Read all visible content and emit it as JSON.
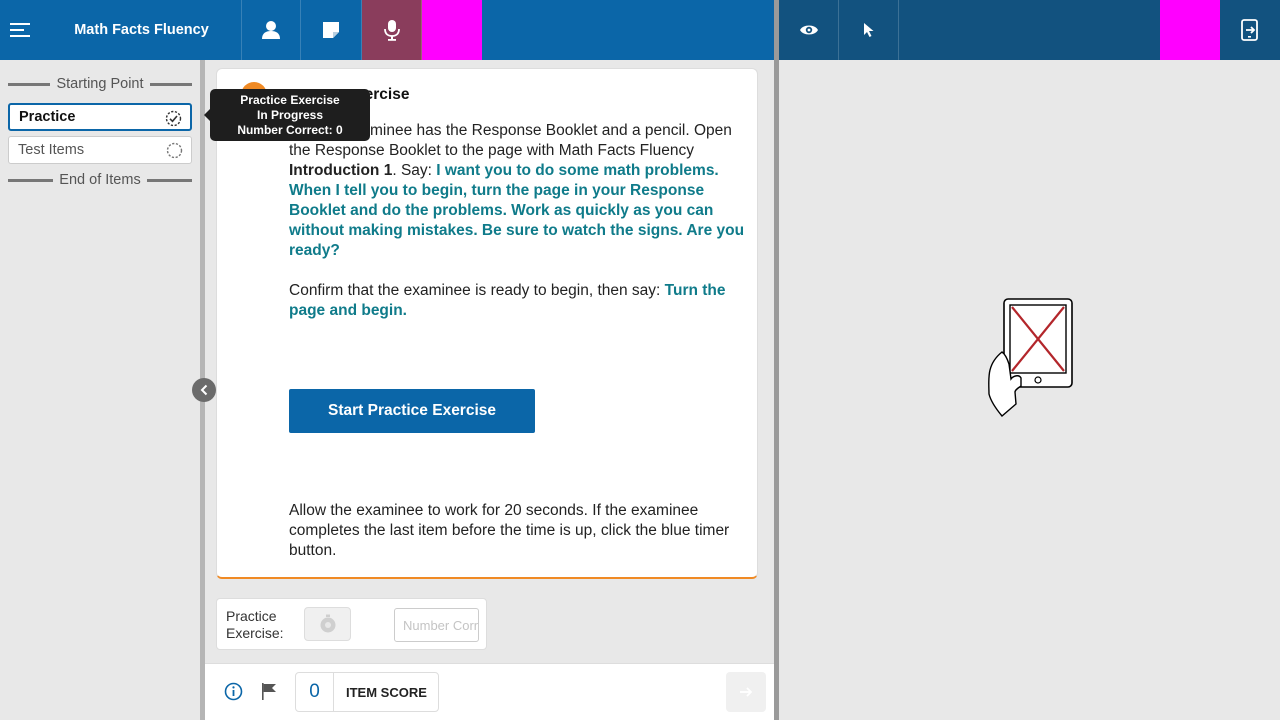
{
  "app": {
    "title": "Math Facts Fluency"
  },
  "toolbar": {
    "icons": [
      "menu-icon",
      "person-icon",
      "notes-icon",
      "microphone-icon",
      "eye-icon",
      "pointer-icon",
      "exit-icon"
    ],
    "colors": {
      "primary": "#0b66a8",
      "secondary": "#12527f",
      "mic_active": "#8a3d5c",
      "highlight": "#ff00ff"
    }
  },
  "sidebar": {
    "start_label": "Starting Point",
    "end_label": "End of Items",
    "items": [
      {
        "label": "Practice",
        "selected": true
      },
      {
        "label": "Test Items",
        "selected": false
      }
    ]
  },
  "tooltip": {
    "line1": "Practice Exercise",
    "line2": "In Progress",
    "line3": "Number Correct: 0"
  },
  "card": {
    "heading": "xercise",
    "p1_intro": "that the examinee has the Response Booklet and a pencil. Open the Response Booklet to the page with Math Facts Fluency ",
    "p1_bold": "Introduction 1",
    "p1_say": ". Say: ",
    "p1_quote": "I want you to do some math problems. When I tell you to begin, turn the page in your Response Booklet and do the problems. Work as quickly as you can without making mistakes. Be sure to watch the signs. Are you ready?",
    "p2_intro": "Confirm that the examinee is ready to begin, then say: ",
    "p2_quote": "Turn the page and begin.",
    "start_button": "Start Practice Exercise",
    "footer": "Allow the examinee to work for 20 seconds. If the examinee completes the last item before the time is up, click the blue timer button.",
    "accent_color": "#f08a24"
  },
  "practice_exercise": {
    "label": "Practice Exercise:",
    "input_placeholder": "Number Correct"
  },
  "bottom": {
    "item_score_value": "0",
    "item_score_label": "ITEM SCORE"
  }
}
